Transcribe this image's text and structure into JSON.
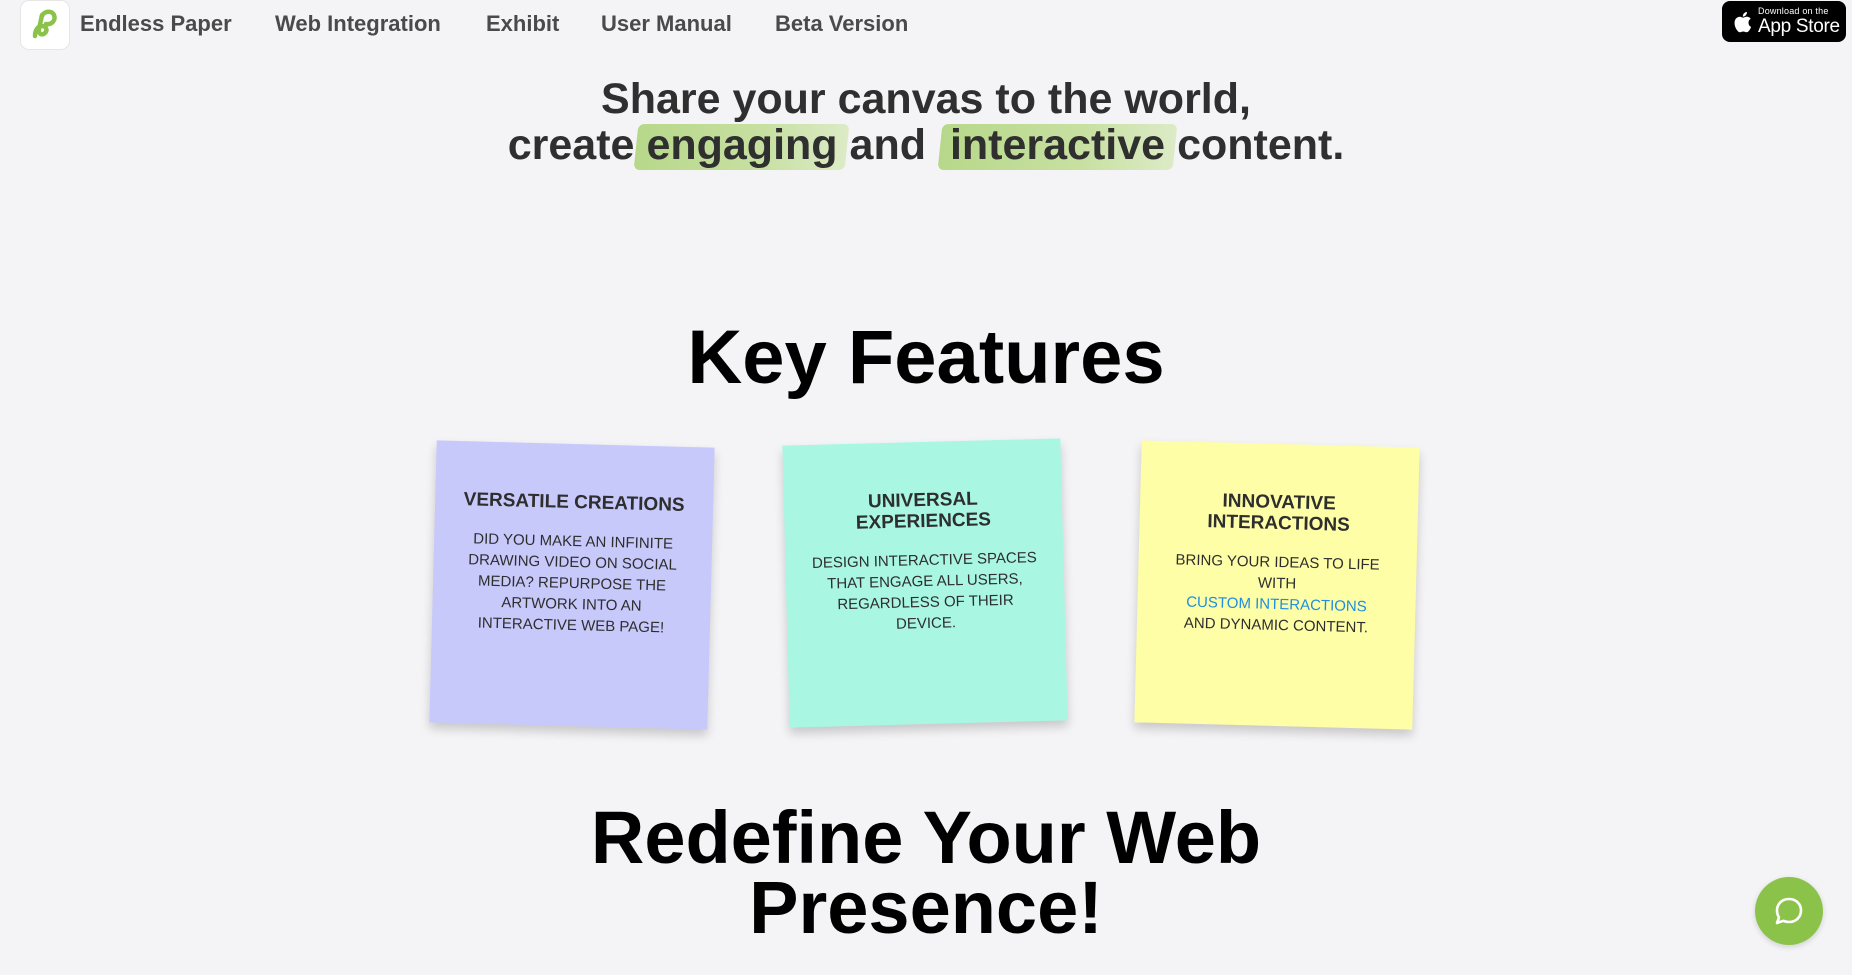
{
  "nav": {
    "brand": "Endless Paper",
    "links": [
      "Web Integration",
      "Exhibit",
      "User Manual",
      "Beta Version"
    ],
    "appstore_small": "Download on the",
    "appstore_big": "App Store"
  },
  "hero": {
    "line1": "Share your canvas to the world,",
    "line2_start": "create",
    "highlight1": "engaging",
    "line2_mid": "and",
    "highlight2": "interactive",
    "line2_end": "content."
  },
  "features": {
    "title": "Key Features",
    "cards": [
      {
        "title": "VERSATILE CREATIONS",
        "body": "DID YOU MAKE AN INFINITE DRAWING VIDEO ON SOCIAL MEDIA? REPURPOSE THE ARTWORK INTO AN INTERACTIVE WEB PAGE!"
      },
      {
        "title": "UNIVERSAL EXPERIENCES",
        "body": "DESIGN INTERACTIVE SPACES THAT ENGAGE ALL USERS, REGARDLESS OF THEIR DEVICE."
      },
      {
        "title": "INNOVATIVE INTERACTIONS",
        "body_before": "BRING YOUR IDEAS TO LIFE WITH",
        "link": "CUSTOM INTERACTIONS",
        "body_after": "AND DYNAMIC CONTENT."
      }
    ]
  },
  "redefine": {
    "line1": "Redefine Your Web",
    "line2": "Presence!"
  },
  "colors": {
    "accent_green": "#8bc34a",
    "card1": "#c8c9fb",
    "card2": "#a9f7e3",
    "card3": "#fefea7",
    "link_blue": "#1e8fe0"
  },
  "icons": [
    "endless-paper-logo-icon",
    "apple-icon",
    "chat-icon"
  ]
}
